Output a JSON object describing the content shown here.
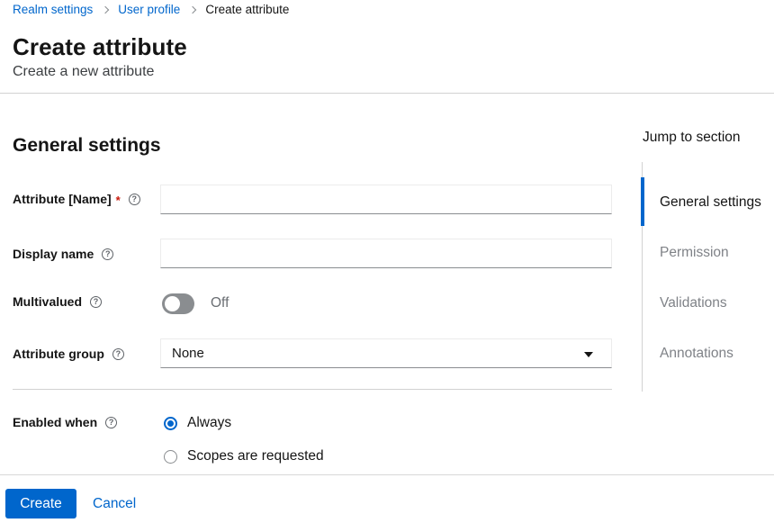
{
  "breadcrumb": {
    "items": [
      {
        "label": "Realm settings",
        "link": true
      },
      {
        "label": "User profile",
        "link": true
      },
      {
        "label": "Create attribute",
        "link": false
      }
    ]
  },
  "header": {
    "title": "Create attribute",
    "subtitle": "Create a new attribute"
  },
  "form": {
    "section_heading": "General settings",
    "fields": {
      "attribute_name": {
        "label": "Attribute [Name]",
        "required": "*",
        "value": ""
      },
      "display_name": {
        "label": "Display name",
        "value": ""
      },
      "multivalued": {
        "label": "Multivalued",
        "state_label": "Off",
        "on": false
      },
      "attribute_group": {
        "label": "Attribute group",
        "selected": "None"
      },
      "enabled_when": {
        "label": "Enabled when",
        "options": [
          {
            "label": "Always",
            "selected": true
          },
          {
            "label": "Scopes are requested",
            "selected": false
          }
        ]
      }
    }
  },
  "jump_to_section": {
    "title": "Jump to section",
    "items": [
      {
        "label": "General settings",
        "active": true
      },
      {
        "label": "Permission",
        "active": false
      },
      {
        "label": "Validations",
        "active": false
      },
      {
        "label": "Annotations",
        "active": false
      }
    ]
  },
  "footer": {
    "create_label": "Create",
    "cancel_label": "Cancel"
  },
  "colors": {
    "accent": "#0066cc",
    "text": "#151515",
    "muted_text": "#6a6e73",
    "divider": "#d2d2d2",
    "toggle_off": "#8a8d90",
    "required": "#c9190b"
  }
}
